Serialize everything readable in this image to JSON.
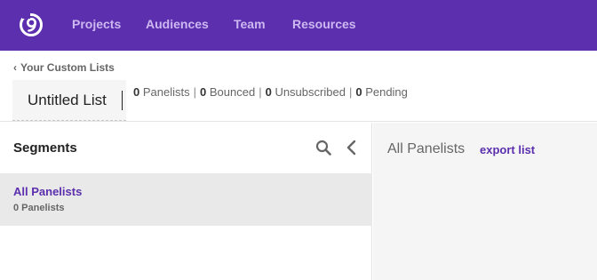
{
  "nav": {
    "logo_icon": "brand-logo-icon",
    "items": [
      {
        "label": "Projects"
      },
      {
        "label": "Audiences"
      },
      {
        "label": "Team"
      },
      {
        "label": "Resources"
      }
    ]
  },
  "subheader": {
    "back_label": "Your Custom Lists",
    "list_name_value": "Untitled List",
    "stats": [
      {
        "count": "0",
        "label": "Panelists"
      },
      {
        "count": "0",
        "label": "Bounced"
      },
      {
        "count": "0",
        "label": "Unsubscribed"
      },
      {
        "count": "0",
        "label": "Pending"
      }
    ]
  },
  "segments": {
    "title": "Segments",
    "items": [
      {
        "name": "All Panelists",
        "count": "0 Panelists",
        "selected": true
      }
    ]
  },
  "detail": {
    "title": "All Panelists",
    "export_label": "export list"
  },
  "colors": {
    "brand": "#5b2fae",
    "nav_text": "#cdb8f1",
    "selected_row": "#e9e9e9",
    "detail_bg": "#f5f5f5"
  }
}
